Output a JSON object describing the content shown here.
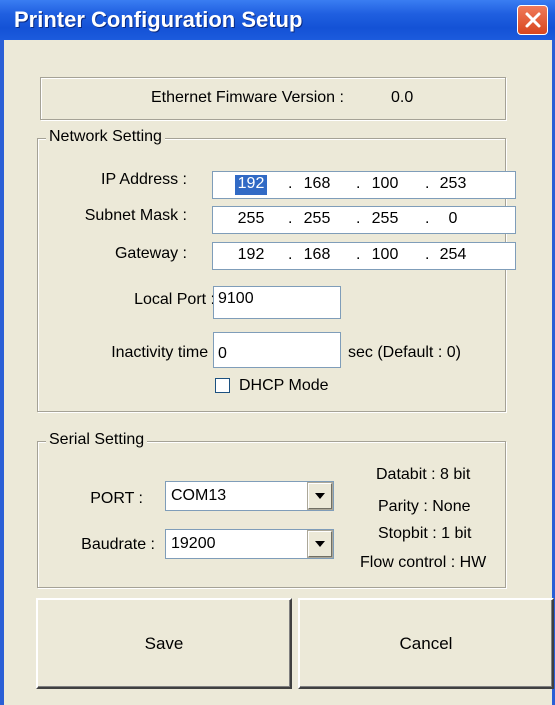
{
  "window": {
    "title": "Printer Configuration Setup",
    "close_icon": "close-icon"
  },
  "firmware": {
    "label": "Ethernet Fimware Version :",
    "value": "0.0"
  },
  "network": {
    "group_title": "Network Setting",
    "ip_label": "IP Address :",
    "ip": [
      "192",
      "168",
      "100",
      "253"
    ],
    "subnet_label": "Subnet Mask :",
    "subnet": [
      "255",
      "255",
      "255",
      "0"
    ],
    "gateway_label": "Gateway :",
    "gateway": [
      "192",
      "168",
      "100",
      "254"
    ],
    "dot": ".",
    "local_port_label": "Local Port :",
    "local_port": "9100",
    "inactivity_label": "Inactivity time :",
    "inactivity": "0",
    "inactivity_suffix": "sec (Default : 0)",
    "dhcp_label": "DHCP Mode",
    "dhcp_checked": false
  },
  "serial": {
    "group_title": "Serial Setting",
    "port_label": "PORT :",
    "port": "COM13",
    "baud_label": "Baudrate :",
    "baud": "19200",
    "databit": "Databit : 8 bit",
    "parity": "Parity : None",
    "stopbit": "Stopbit : 1 bit",
    "flow": "Flow control : HW"
  },
  "buttons": {
    "save": "Save",
    "cancel": "Cancel"
  },
  "colors": {
    "title_bar": "#1f5fe0",
    "close_button": "#e0582e",
    "dialog_bg": "#ece9d8",
    "selection": "#316ac5"
  }
}
